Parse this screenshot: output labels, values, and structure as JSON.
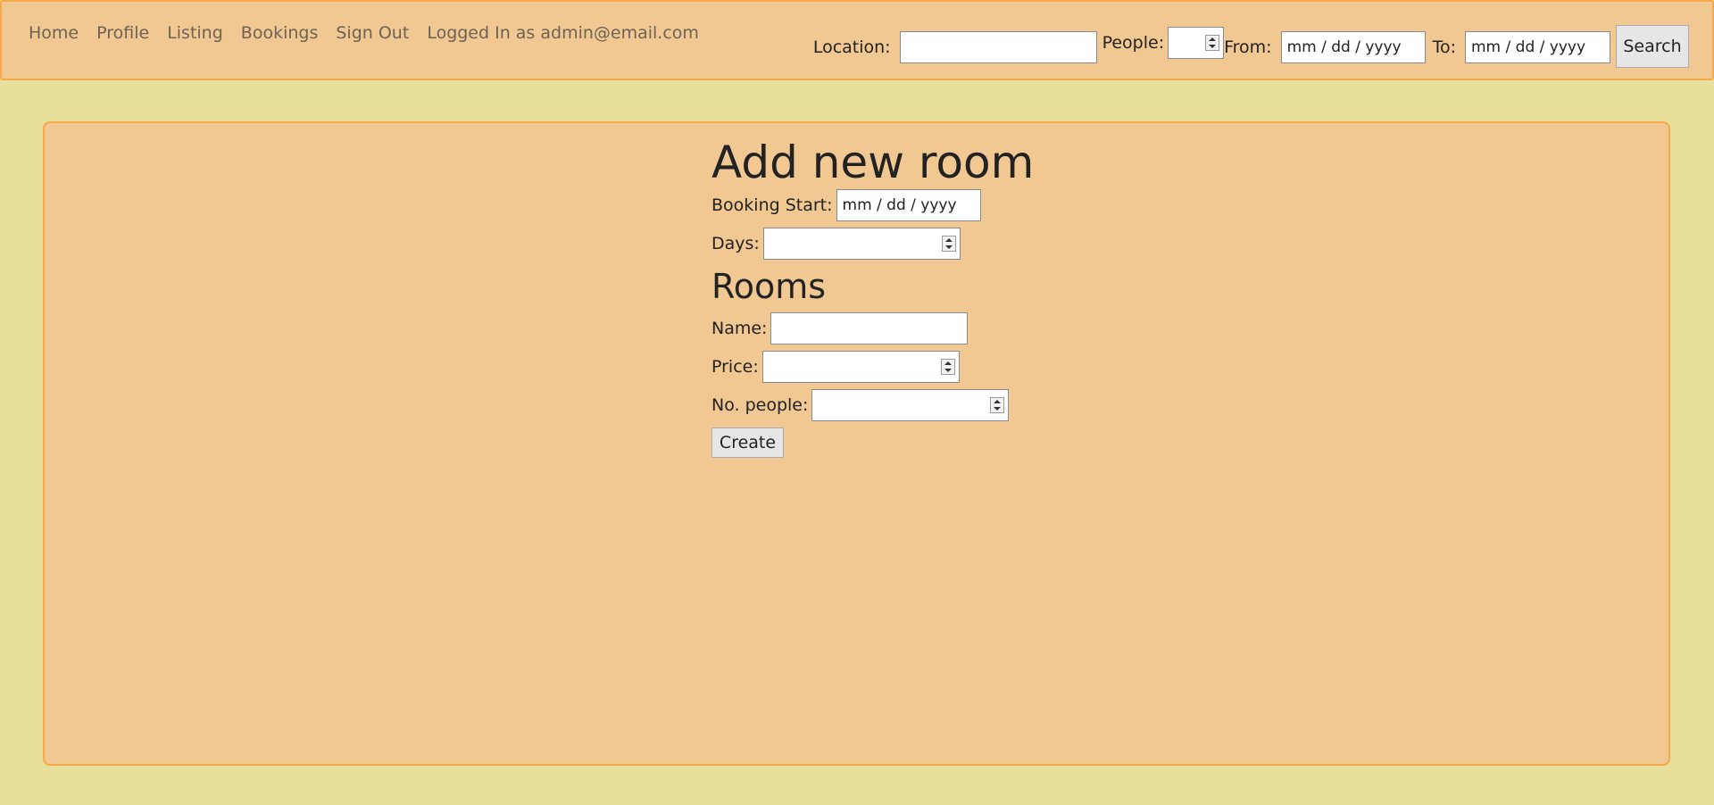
{
  "nav": {
    "links": [
      "Home",
      "Profile",
      "Listing",
      "Bookings",
      "Sign Out"
    ],
    "logged_in_text": "Logged In as admin@email.com"
  },
  "search": {
    "location_label": "Location:",
    "location_value": "",
    "people_label": "People:",
    "people_value": "",
    "from_label": "From:",
    "from_placeholder": "mm / dd / yyyy",
    "to_label": "To:",
    "to_placeholder": "mm / dd / yyyy",
    "button_label": "Search"
  },
  "form": {
    "title": "Add new room",
    "booking_start_label": "Booking Start:",
    "booking_start_placeholder": "mm / dd / yyyy",
    "days_label": "Days:",
    "days_value": "",
    "rooms_heading": "Rooms",
    "name_label": "Name:",
    "name_value": "",
    "price_label": "Price:",
    "price_value": "",
    "people_label": "No. people:",
    "people_value": "",
    "create_label": "Create"
  },
  "colors": {
    "page_background": "#e8e09a",
    "panel_background": "#f2c892",
    "panel_border": "#f5a94a",
    "nav_link_text": "#6d6256"
  },
  "icons": {
    "spinner": "up-down-spinner-icon"
  }
}
